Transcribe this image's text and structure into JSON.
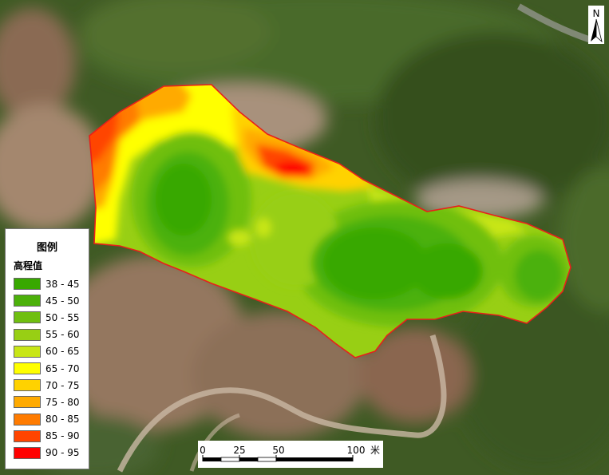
{
  "legend": {
    "title": "图例",
    "subtitle": "高程值",
    "items": [
      {
        "label": "38 - 45",
        "color": "#38a800"
      },
      {
        "label": "45 - 50",
        "color": "#4cb10a"
      },
      {
        "label": "50 - 55",
        "color": "#6fbf10"
      },
      {
        "label": "55 - 60",
        "color": "#98cf14"
      },
      {
        "label": "60 - 65",
        "color": "#c8e616"
      },
      {
        "label": "65 - 70",
        "color": "#ffff00"
      },
      {
        "label": "70 - 75",
        "color": "#ffd200"
      },
      {
        "label": "75 - 80",
        "color": "#ffaa00"
      },
      {
        "label": "80 - 85",
        "color": "#ff7b00"
      },
      {
        "label": "85 - 90",
        "color": "#ff4400"
      },
      {
        "label": "90 - 95",
        "color": "#ff0000"
      }
    ]
  },
  "scale_bar": {
    "labels": [
      "0",
      "25",
      "50",
      "100"
    ],
    "unit": "米"
  },
  "north_arrow": {
    "letter": "N",
    "icon": "north-arrow-icon"
  },
  "colors": {
    "boundary": "#e8201a",
    "vegetation": "#3f5a24",
    "bare_soil": "#9a7b62"
  }
}
